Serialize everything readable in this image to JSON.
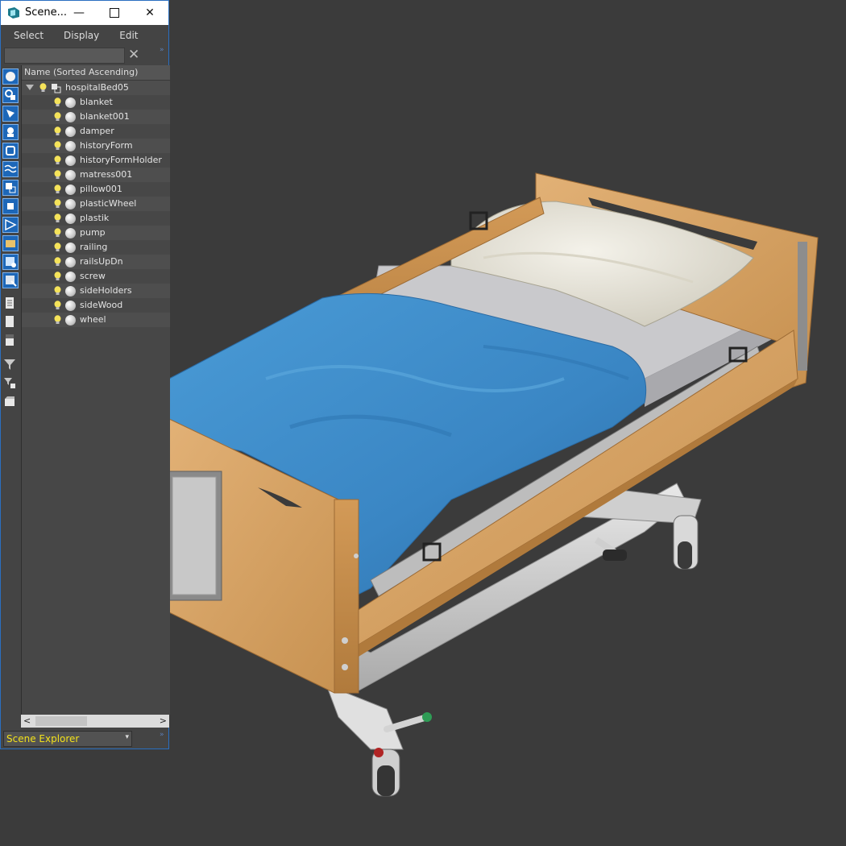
{
  "window": {
    "title": "Scene...",
    "min_icon": "minimize-icon",
    "max_icon": "maximize-icon",
    "close_icon": "close-icon"
  },
  "menu": [
    "Select",
    "Display",
    "Edit"
  ],
  "search": {
    "placeholder": "",
    "clear_glyph": "✕",
    "expand_glyph": "»"
  },
  "tree": {
    "column_header": "Name (Sorted Ascending)",
    "root": "hospitalBed05",
    "children": [
      "blanket",
      "blanket001",
      "damper",
      "historyForm",
      "historyFormHolder",
      "matress001",
      "pillow001",
      "plasticWheel",
      "plastik",
      "pump",
      "railing",
      "railsUpDn",
      "screw",
      "sideHolders",
      "sideWood",
      "wheel"
    ]
  },
  "toolbar_icons": [
    "display-geometry-icon",
    "display-shapes-icon",
    "display-lights-icon",
    "display-cameras-icon",
    "display-helpers-icon",
    "display-spacewarps-icon",
    "display-groups-icon",
    "display-xrefs-icon",
    "display-bones-icon",
    "display-containers-icon",
    "display-frozen-icon",
    "display-hidden-icon",
    "display-all-icon",
    "display-none-icon",
    "invert-display-icon",
    "filter-icon",
    "filter-selection-icon",
    "layer-explorer-icon"
  ],
  "footer": {
    "explorer_select": "Scene Explorer",
    "expand_glyph": "»"
  },
  "colors": {
    "accent": "#2a6fc1",
    "viewport_bg": "#3b3b3b",
    "panel_bg": "#444444",
    "select_text": "#f3e21b",
    "blanket": "#3d8fcc",
    "wood": "#d7a565"
  }
}
